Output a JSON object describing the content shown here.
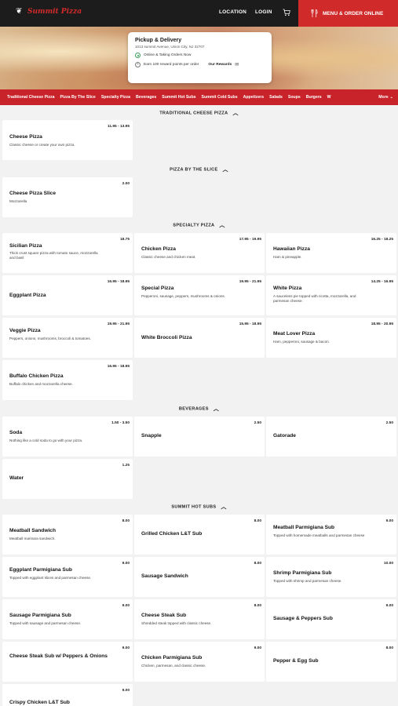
{
  "header": {
    "logo_text": "Summit Pizza",
    "nav": {
      "location": "LOCATION",
      "login": "LOGIN"
    },
    "order_button": "MENU & ORDER ONLINE"
  },
  "pickup": {
    "title": "Pickup & Delivery",
    "address": "1013 summit Avenue, Union City, NJ 32707",
    "status": "Online & Taking Orders Now",
    "rewards_text": "Earn 100 reward points per order",
    "rewards_link": "Our Rewards"
  },
  "categories": {
    "items": [
      "Traditional Cheese Pizza",
      "Pizza By The Slice",
      "Specialty Pizza",
      "Beverages",
      "Summit Hot Subs",
      "Summit Cold Subs",
      "Appetizers",
      "Salads",
      "Soups",
      "Burgers",
      "W"
    ],
    "more": "More"
  },
  "sections": {
    "traditional": "TRADITIONAL CHEESE PIZZA",
    "slice": "PIZZA BY THE SLICE",
    "specialty": "SPECIALTY PIZZA",
    "beverages": "BEVERAGES",
    "hot_subs": "SUMMIT HOT SUBS"
  },
  "items": {
    "cheese_pizza": {
      "name": "Cheese Pizza",
      "price": "11.95 - 13.95",
      "desc": "Classic cheese or create your own pizza."
    },
    "cheese_slice": {
      "name": "Cheese Pizza Slice",
      "price": "2.00",
      "desc": "Mozzarella"
    },
    "sicilian": {
      "name": "Sicilian Pizza",
      "price": "18.75",
      "desc": "Thick crust square pizza with tomato sauce, mozzarella and basil"
    },
    "chicken_pizza": {
      "name": "Chicken Pizza",
      "price": "17.95 - 19.95",
      "desc": "Classic cheese and chicken meat."
    },
    "hawaiian": {
      "name": "Hawaiian Pizza",
      "price": "16.25 - 18.25",
      "desc": "Ham & pineapple."
    },
    "eggplant_pizza": {
      "name": "Eggplant Pizza",
      "price": "16.95 - 18.95",
      "desc": ""
    },
    "special_pizza": {
      "name": "Special Pizza",
      "price": "19.95 - 21.95",
      "desc": "Pepperoni, sausage, peppers, mushrooms & onions."
    },
    "white_pizza": {
      "name": "White Pizza",
      "price": "14.25 - 16.95",
      "desc": "A sauceless pie topped with ricotta, mozzarella, and parmesan cheese."
    },
    "veggie": {
      "name": "Veggie Pizza",
      "price": "19.95 - 21.95",
      "desc": "Peppers, onions, mushrooms, broccoli & tomatoes."
    },
    "white_broccoli": {
      "name": "White Broccoli Pizza",
      "price": "15.95 - 18.95",
      "desc": ""
    },
    "meat_lover": {
      "name": "Meat Lover Pizza",
      "price": "18.95 - 20.95",
      "desc": "Ham, pepperoni, sausage & bacon."
    },
    "buffalo": {
      "name": "Buffalo Chicken Pizza",
      "price": "16.95 - 18.95",
      "desc": "Buffalo chicken and mozzarella cheese."
    },
    "soda": {
      "name": "Soda",
      "price": "1.50 - 3.50",
      "desc": "Nothing like a cold soda to go with your pizza."
    },
    "snapple": {
      "name": "Snapple",
      "price": "2.50",
      "desc": ""
    },
    "gatorade": {
      "name": "Gatorade",
      "price": "2.50",
      "desc": ""
    },
    "water": {
      "name": "Water",
      "price": "1.25",
      "desc": ""
    },
    "meatball_sandwich": {
      "name": "Meatball Sandwich",
      "price": "8.00",
      "desc": "Meatball marinara sandwich."
    },
    "grilled_chicken": {
      "name": "Grilled Chicken L&T Sub",
      "price": "8.00",
      "desc": ""
    },
    "meatball_parm": {
      "name": "Meatball Parmigiana Sub",
      "price": "9.00",
      "desc": "Topped with homemade meatballs and parmesan cheese"
    },
    "eggplant_parm": {
      "name": "Eggplant Parmigiana Sub",
      "price": "9.00",
      "desc": "Topped with eggplant slices and parmesan cheese."
    },
    "sausage_sandwich": {
      "name": "Sausage Sandwich",
      "price": "8.00",
      "desc": ""
    },
    "shrimp_parm": {
      "name": "Shrimp Parmigiana Sub",
      "price": "10.00",
      "desc": "Topped with shrimp and parmesan cheese."
    },
    "sausage_parm": {
      "name": "Sausage Parmigiana Sub",
      "price": "9.00",
      "desc": "Topped with sausage and parmesan cheese."
    },
    "cheese_steak": {
      "name": "Cheese Steak Sub",
      "price": "8.00",
      "desc": "Shredded steak topped with classic cheese."
    },
    "sausage_peppers": {
      "name": "Sausage & Peppers Sub",
      "price": "9.00",
      "desc": ""
    },
    "cheese_steak_peppers": {
      "name": "Cheese Steak Sub w/ Peppers & Onions",
      "price": "9.00",
      "desc": ""
    },
    "chicken_parm": {
      "name": "Chicken Parmigiana Sub",
      "price": "9.00",
      "desc": "Chicken, parmesan, and classic cheese."
    },
    "pepper_egg": {
      "name": "Pepper & Egg Sub",
      "price": "8.00",
      "desc": ""
    },
    "crispy_chicken": {
      "name": "Crispy Chicken L&T Sub",
      "price": "9.00",
      "desc": ""
    }
  }
}
